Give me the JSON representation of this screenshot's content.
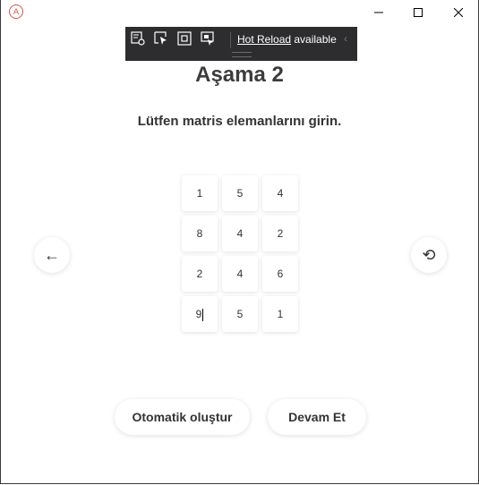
{
  "window": {
    "app_icon_letter": "A",
    "minimize_icon": "minimize-icon",
    "maximize_icon": "maximize-icon",
    "close_icon": "close-icon"
  },
  "hot_reload_toolbar": {
    "link_text": "Hot Reload",
    "status_text": " available",
    "collapse_glyph": "‹",
    "tools": [
      "visual-tree-icon",
      "select-element-icon",
      "display-layout-adorners-icon",
      "track-focused-element-icon"
    ]
  },
  "page": {
    "title": "Aşama 2",
    "subtitle": "Lütfen matris elemanlarını girin."
  },
  "matrix": {
    "rows": [
      [
        "1",
        "5",
        "4"
      ],
      [
        "8",
        "4",
        "2"
      ],
      [
        "2",
        "4",
        "6"
      ],
      [
        "9",
        "5",
        "1"
      ]
    ]
  },
  "nav": {
    "back_glyph": "←",
    "reset_glyph": "⟲"
  },
  "actions": {
    "auto_generate_label": "Otomatik oluştur",
    "continue_label": "Devam Et"
  }
}
